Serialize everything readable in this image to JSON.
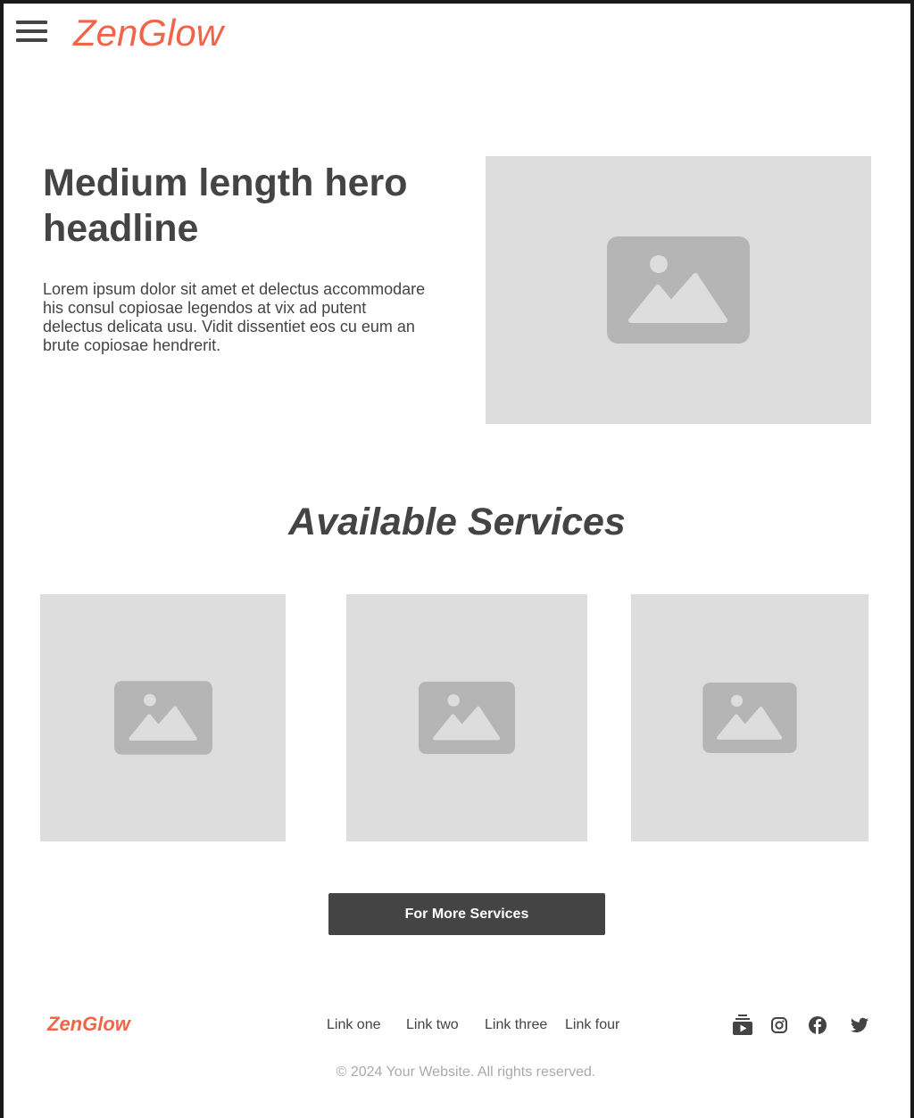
{
  "header": {
    "logo": "ZenGlow",
    "menu_icon": "hamburger-menu-icon"
  },
  "hero": {
    "headline": "Medium length hero headline",
    "body": "Lorem ipsum dolor sit amet et delectus accommodare his consul copiosae legendos at vix ad putent delectus delicata usu. Vidit dissentiet eos cu eum an brute copiosae hendrerit.",
    "image_icon": "image-placeholder-icon"
  },
  "services": {
    "title": "Available Services",
    "cards": [
      {
        "image_icon": "image-placeholder-icon"
      },
      {
        "image_icon": "image-placeholder-icon"
      },
      {
        "image_icon": "image-placeholder-icon"
      }
    ],
    "button_label": "For More Services"
  },
  "footer": {
    "logo": "ZenGlow",
    "links": [
      "Link one",
      "Link two",
      "Link three",
      "Link four"
    ],
    "social_icons": [
      "youtube-icon",
      "instagram-icon",
      "facebook-icon",
      "twitter-icon"
    ],
    "copyright": "© 2024 Your Website. All rights reserved."
  },
  "colors": {
    "brand": "#f0644a",
    "text": "#444444",
    "placeholder_bg": "#dddddd",
    "placeholder_icon": "#b5b5b5",
    "button_bg": "#444444",
    "muted": "#aaaaaa"
  }
}
